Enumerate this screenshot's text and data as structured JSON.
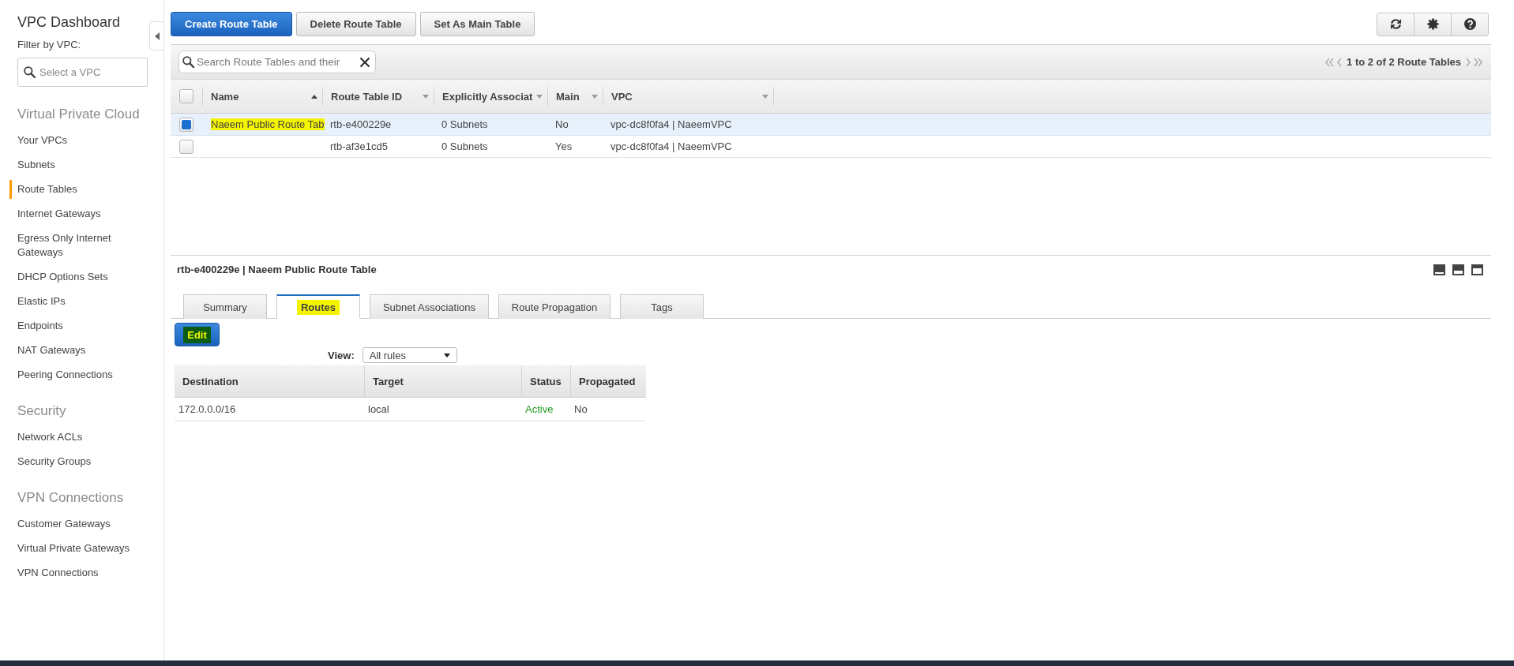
{
  "sidebar": {
    "title": "VPC Dashboard",
    "filter_label": "Filter by VPC:",
    "filter": {
      "placeholder": "Select a VPC"
    },
    "sections": [
      {
        "heading": "Virtual Private Cloud",
        "items": [
          {
            "label": "Your VPCs",
            "selected": false
          },
          {
            "label": "Subnets",
            "selected": false
          },
          {
            "label": "Route Tables",
            "selected": true
          },
          {
            "label": "Internet Gateways",
            "selected": false
          },
          {
            "label": "Egress Only Internet Gateways",
            "selected": false
          },
          {
            "label": "DHCP Options Sets",
            "selected": false
          },
          {
            "label": "Elastic IPs",
            "selected": false
          },
          {
            "label": "Endpoints",
            "selected": false
          },
          {
            "label": "NAT Gateways",
            "selected": false
          },
          {
            "label": "Peering Connections",
            "selected": false
          }
        ]
      },
      {
        "heading": "Security",
        "items": [
          {
            "label": "Network ACLs",
            "selected": false
          },
          {
            "label": "Security Groups",
            "selected": false
          }
        ]
      },
      {
        "heading": "VPN Connections",
        "items": [
          {
            "label": "Customer Gateways",
            "selected": false
          },
          {
            "label": "Virtual Private Gateways",
            "selected": false
          },
          {
            "label": "VPN Connections",
            "selected": false
          }
        ]
      }
    ]
  },
  "toolbar": {
    "buttons": [
      {
        "label": "Create Route Table",
        "kind": "primary"
      },
      {
        "label": "Delete Route Table",
        "kind": "default"
      },
      {
        "label": "Set As Main Table",
        "kind": "default"
      }
    ]
  },
  "route_tables": {
    "search": {
      "placeholder": "Search Route Tables and their"
    },
    "pagination": "1 to 2 of 2 Route Tables",
    "select_all_checked": false,
    "columns": [
      {
        "label": "Name",
        "sorted": true
      },
      {
        "label": "Route Table ID",
        "sorted": false
      },
      {
        "label": "Explicitly Associat",
        "sorted": false
      },
      {
        "label": "Main",
        "sorted": false
      },
      {
        "label": "VPC",
        "sorted": false
      }
    ],
    "rows": [
      {
        "selected": true,
        "checked": true,
        "name": {
          "text": "Naeem Public Route Tab",
          "highlighted": true
        },
        "route_table_id": "rtb-e400229e",
        "explicitly_associated": "0 Subnets",
        "main": "No",
        "vpc": "vpc-dc8f0fa4 | NaeemVPC"
      },
      {
        "selected": false,
        "checked": false,
        "route_table_id": "rtb-af3e1cd5",
        "explicitly_associated": "0 Subnets",
        "main": "Yes",
        "vpc": "vpc-dc8f0fa4 | NaeemVPC"
      }
    ]
  },
  "details": {
    "title": "rtb-e400229e | Naeem Public Route Table",
    "tabs": [
      {
        "label": "Summary",
        "selected": false,
        "highlighted": false
      },
      {
        "label": "Routes",
        "selected": true,
        "highlighted": true
      },
      {
        "label": "Subnet Associations",
        "selected": false,
        "highlighted": false
      },
      {
        "label": "Route Propagation",
        "selected": false,
        "highlighted": false
      },
      {
        "label": "Tags",
        "selected": false,
        "highlighted": false
      }
    ],
    "edit_button": {
      "label": "Edit",
      "highlighted": true
    },
    "view": {
      "label": "View:",
      "value": "All rules"
    },
    "routes": {
      "columns": [
        "Destination",
        "Target",
        "Status",
        "Propagated"
      ],
      "rows": [
        {
          "destination": "172.0.0.0/16",
          "target": "local",
          "status": "Active",
          "color": "#1e9a1e",
          "propagated": "No"
        }
      ]
    }
  }
}
